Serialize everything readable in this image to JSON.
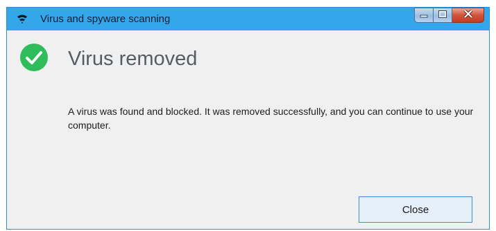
{
  "window": {
    "title": "Virus and spyware scanning",
    "icons": {
      "app": "shield-wifi-icon",
      "minimize": "minimize-icon",
      "maximize": "maximize-icon",
      "close": "close-icon"
    }
  },
  "dialog": {
    "status_icon": "checkmark-circle-icon",
    "heading": "Virus removed",
    "message": "A virus was found and blocked. It was removed successfully, and you can continue to use your computer.",
    "close_button_label": "Close"
  },
  "colors": {
    "titlebar": "#34a7ea",
    "success": "#2ebd5a",
    "window_bg": "#f0f0f0",
    "button_border": "#3d8bd8",
    "button_bg": "#e5f0fb"
  }
}
